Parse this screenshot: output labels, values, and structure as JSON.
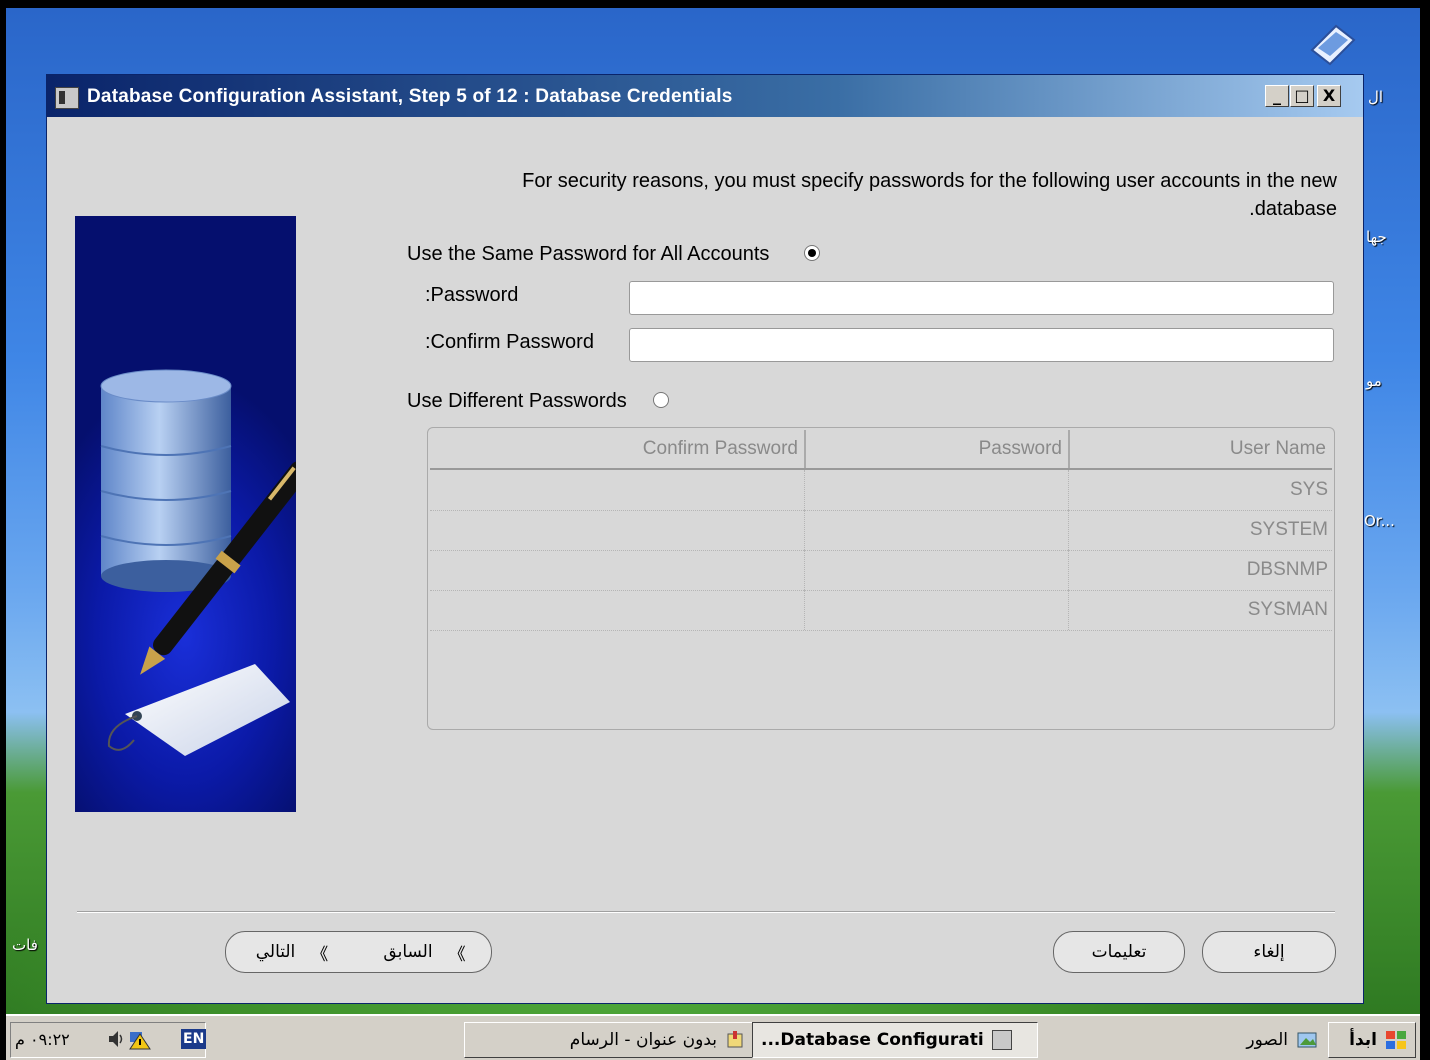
{
  "window": {
    "title": "Database Configuration Assistant, Step 5 of 12 : Database Credentials",
    "minimize": "_",
    "maximize": "□",
    "close": "X"
  },
  "instruction": {
    "line1": "For security reasons, you must specify passwords for the following user accounts in the new",
    "line2": ".database"
  },
  "same_password": {
    "radio_label": "Use the Same Password for All Accounts",
    "selected": true,
    "password_label": ":Password",
    "password_value": "",
    "confirm_label": ":Confirm Password",
    "confirm_value": ""
  },
  "different_passwords": {
    "radio_label": "Use Different Passwords",
    "selected": false,
    "columns": [
      "Confirm Password",
      "Password",
      "User Name"
    ],
    "rows": [
      {
        "user": "SYS",
        "password": "",
        "confirm": ""
      },
      {
        "user": "SYSTEM",
        "password": "",
        "confirm": ""
      },
      {
        "user": "DBSNMP",
        "password": "",
        "confirm": ""
      },
      {
        "user": "SYSMAN",
        "password": "",
        "confirm": ""
      }
    ]
  },
  "buttons": {
    "cancel": "إلغاء",
    "help": "تعليمات",
    "back": "السابق",
    "back_arrow": "《",
    "next": "التالي",
    "next_arrow": "《"
  },
  "desktop": {
    "labels": [
      "ال",
      "جها",
      "مو",
      "Or...",
      "فات"
    ]
  },
  "taskbar": {
    "start": "ابدأ",
    "quick_launch": "الصور",
    "dbca_task": "...Database Configurati",
    "paint_task": "بدون عنوان - الرسام",
    "lang": "EN",
    "clock": "٠٩:٢٢ م"
  }
}
